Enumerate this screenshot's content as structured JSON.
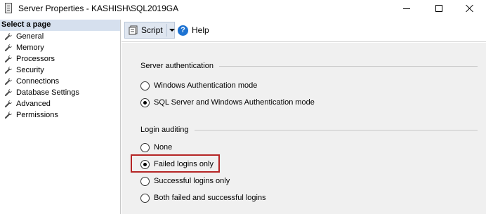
{
  "window": {
    "title": "Server Properties - KASHISH\\SQL2019GA",
    "controls": [
      "minimize-icon",
      "maximize-icon",
      "close-icon"
    ]
  },
  "left_pane": {
    "header": "Select a page",
    "pages": [
      {
        "label": "General",
        "icon": "wrench-icon"
      },
      {
        "label": "Memory",
        "icon": "wrench-icon"
      },
      {
        "label": "Processors",
        "icon": "wrench-icon"
      },
      {
        "label": "Security",
        "icon": "wrench-icon"
      },
      {
        "label": "Connections",
        "icon": "wrench-icon"
      },
      {
        "label": "Database Settings",
        "icon": "wrench-icon"
      },
      {
        "label": "Advanced",
        "icon": "wrench-icon"
      },
      {
        "label": "Permissions",
        "icon": "wrench-icon"
      }
    ]
  },
  "toolbar": {
    "script_label": "Script",
    "help_label": "Help"
  },
  "server_authentication": {
    "title": "Server authentication",
    "options": [
      {
        "label": "Windows Authentication mode",
        "checked": false
      },
      {
        "label": "SQL Server and Windows Authentication mode",
        "checked": true
      }
    ]
  },
  "login_auditing": {
    "title": "Login auditing",
    "options": [
      {
        "label": "None",
        "checked": false
      },
      {
        "label": "Failed logins only",
        "checked": true
      },
      {
        "label": "Successful logins only",
        "checked": false
      },
      {
        "label": "Both failed and successful logins",
        "checked": false
      }
    ],
    "highlighted_option": "Failed logins only"
  },
  "colors": {
    "header_bg": "#d6e0ee",
    "content_bg": "#f0f0f0",
    "highlight_border": "#b52525",
    "help_icon": "#1e73d2"
  }
}
